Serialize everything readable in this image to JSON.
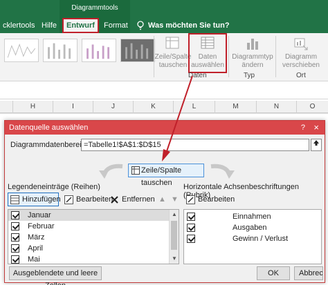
{
  "ribbon": {
    "context_group": "Diagrammtools",
    "tabs": [
      {
        "label": "cklertools",
        "active": false
      },
      {
        "label": "Hilfe",
        "active": false
      },
      {
        "label": "Entwurf",
        "active": true
      },
      {
        "label": "Format",
        "active": false
      }
    ],
    "tell_me": "Was möchten Sie tun?",
    "buttons": {
      "switch_row_col": "Zeile/Spalte tauschen",
      "select_data": "Daten auswählen",
      "change_type": "Diagrammtyp ändern",
      "move_chart": "Diagramm verschieben"
    },
    "group_labels": {
      "data": "Daten",
      "type": "Typ",
      "location": "Ort"
    }
  },
  "sheet": {
    "columns": [
      "H",
      "I",
      "J",
      "K",
      "L",
      "M",
      "N",
      "O"
    ]
  },
  "dialog": {
    "title": "Datenquelle auswählen",
    "help": "?",
    "close": "×",
    "range_label": "Diagrammdatenbereich:",
    "range_value": "=Tabelle1!$A$1:$D$15",
    "swap_label": "Zeile/Spalte tauschen",
    "legend_title": "Legendeneinträge (Reihen)",
    "legend_toolbar": {
      "add": "Hinzufügen",
      "edit": "Bearbeiten",
      "remove": "Entfernen"
    },
    "legend_items": [
      "Januar",
      "Februar",
      "März",
      "April",
      "Mai"
    ],
    "axis_title": "Horizontale Achsenbeschriftungen (Rubrik)",
    "axis_toolbar": {
      "edit": "Bearbeiten"
    },
    "axis_items": [
      "Einnahmen",
      "Ausgaben",
      "Gewinn / Verlust"
    ],
    "hidden_cells": "Ausgeblendete und leere Zellen",
    "ok": "OK",
    "cancel": "Abbrechen"
  },
  "colors": {
    "ribbon_green": "#217346",
    "dialog_title": "#d9474a",
    "highlight_red": "#c0202a"
  }
}
